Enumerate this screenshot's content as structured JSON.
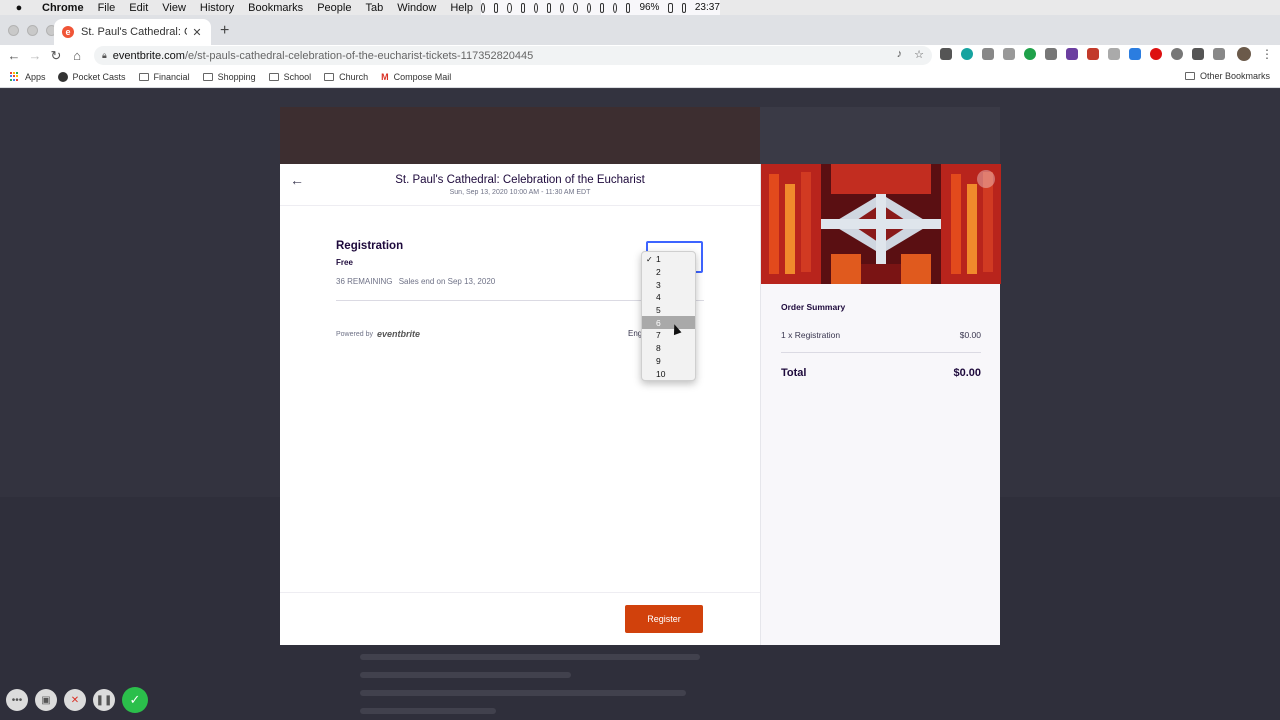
{
  "menubar": {
    "app": "Chrome",
    "items": [
      "File",
      "Edit",
      "View",
      "History",
      "Bookmarks",
      "People",
      "Tab",
      "Window",
      "Help"
    ],
    "battery": "96%",
    "time": "23:37"
  },
  "tab": {
    "title": "St. Paul's Cathedral: Celebratio",
    "favicon": "eventbrite-e"
  },
  "address": {
    "domain": "eventbrite.com",
    "path": "/e/st-pauls-cathedral-celebration-of-the-eucharist-tickets-117352820445"
  },
  "bookmarks": {
    "items": [
      "Apps",
      "Pocket Casts",
      "Financial",
      "Shopping",
      "School",
      "Church",
      "Compose Mail"
    ],
    "other": "Other Bookmarks"
  },
  "modal": {
    "title": "St. Paul's Cathedral: Celebration of the Eucharist",
    "date": "Sun, Sep 13, 2020 10:00 AM - 11:30 AM EDT",
    "ticket": {
      "name": "Registration",
      "price": "Free",
      "remaining": "36 REMAINING",
      "sales_end": "Sales end on Sep 13, 2020"
    },
    "powered_by": "Powered by",
    "brand": "eventbrite",
    "language": "Eng",
    "register_label": "Register"
  },
  "summary": {
    "title": "Order Summary",
    "line_label": "1 x Registration",
    "line_value": "$0.00",
    "total_label": "Total",
    "total_value": "$0.00"
  },
  "dropdown": {
    "options": [
      "1",
      "2",
      "3",
      "4",
      "5",
      "6",
      "7",
      "8",
      "9",
      "10"
    ],
    "selected": "1",
    "highlighted": "6"
  },
  "colors": {
    "accent": "#d1410c",
    "focus": "#3d64ff",
    "record_ok": "#2bbf4b"
  }
}
